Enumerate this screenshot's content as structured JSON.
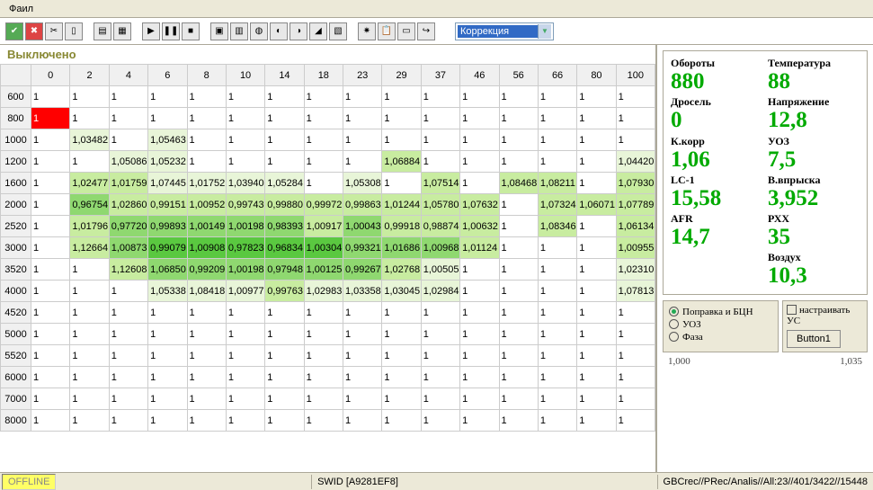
{
  "menu": {
    "file": "Фаил"
  },
  "toolbar": {
    "combo_label": "Коррекция"
  },
  "status_label": "Выключено",
  "columns": [
    "0",
    "2",
    "4",
    "6",
    "8",
    "10",
    "14",
    "18",
    "23",
    "29",
    "37",
    "46",
    "56",
    "66",
    "80",
    "100"
  ],
  "rows": [
    "600",
    "800",
    "1000",
    "1200",
    "1600",
    "2000",
    "2520",
    "3000",
    "3520",
    "4000",
    "4520",
    "5000",
    "5520",
    "6000",
    "7000",
    "8000"
  ],
  "cells": [
    [
      [
        "1",
        ""
      ],
      [
        "1",
        ""
      ],
      [
        "1",
        ""
      ],
      [
        "1",
        ""
      ],
      [
        "1",
        ""
      ],
      [
        "1",
        ""
      ],
      [
        "1",
        ""
      ],
      [
        "1",
        ""
      ],
      [
        "1",
        ""
      ],
      [
        "1",
        ""
      ],
      [
        "1",
        ""
      ],
      [
        "1",
        ""
      ],
      [
        "1",
        ""
      ],
      [
        "1",
        ""
      ],
      [
        "1",
        ""
      ],
      [
        "1",
        ""
      ]
    ],
    [
      [
        "1",
        "red"
      ],
      [
        "1",
        ""
      ],
      [
        "1",
        ""
      ],
      [
        "1",
        ""
      ],
      [
        "1",
        ""
      ],
      [
        "1",
        ""
      ],
      [
        "1",
        ""
      ],
      [
        "1",
        ""
      ],
      [
        "1",
        ""
      ],
      [
        "1",
        ""
      ],
      [
        "1",
        ""
      ],
      [
        "1",
        ""
      ],
      [
        "1",
        ""
      ],
      [
        "1",
        ""
      ],
      [
        "1",
        ""
      ],
      [
        "1",
        ""
      ]
    ],
    [
      [
        "1",
        ""
      ],
      [
        "1,03482",
        "g1"
      ],
      [
        "1",
        ""
      ],
      [
        "1,05463",
        "g1"
      ],
      [
        "1",
        ""
      ],
      [
        "1",
        ""
      ],
      [
        "1",
        ""
      ],
      [
        "1",
        ""
      ],
      [
        "1",
        ""
      ],
      [
        "1",
        ""
      ],
      [
        "1",
        ""
      ],
      [
        "1",
        ""
      ],
      [
        "1",
        ""
      ],
      [
        "1",
        ""
      ],
      [
        "1",
        ""
      ],
      [
        "1",
        ""
      ]
    ],
    [
      [
        "1",
        ""
      ],
      [
        "1",
        ""
      ],
      [
        "1,05086",
        "g1"
      ],
      [
        "1,05232",
        "g1"
      ],
      [
        "1",
        ""
      ],
      [
        "1",
        ""
      ],
      [
        "1",
        ""
      ],
      [
        "1",
        ""
      ],
      [
        "1",
        ""
      ],
      [
        "1,06884",
        "g2"
      ],
      [
        "1",
        ""
      ],
      [
        "1",
        ""
      ],
      [
        "1",
        ""
      ],
      [
        "1",
        ""
      ],
      [
        "1",
        ""
      ],
      [
        "1,04420",
        "g1"
      ]
    ],
    [
      [
        "1",
        ""
      ],
      [
        "1,02477",
        "g2"
      ],
      [
        "1,01759",
        "g2"
      ],
      [
        "1,07445",
        "g1"
      ],
      [
        "1,01752",
        "g1"
      ],
      [
        "1,03940",
        "g1"
      ],
      [
        "1,05284",
        "g1"
      ],
      [
        "1",
        ""
      ],
      [
        "1,05308",
        "g1"
      ],
      [
        "1",
        ""
      ],
      [
        "1,07514",
        "g2"
      ],
      [
        "1",
        ""
      ],
      [
        "1,08468",
        "g2"
      ],
      [
        "1,08211",
        "g2"
      ],
      [
        "1",
        ""
      ],
      [
        "1,07930",
        "g2"
      ]
    ],
    [
      [
        "1",
        ""
      ],
      [
        "0,96754",
        "g3"
      ],
      [
        "1,02860",
        "g2"
      ],
      [
        "0,99151",
        "g2"
      ],
      [
        "1,00952",
        "g2"
      ],
      [
        "0,99743",
        "g2"
      ],
      [
        "0,99880",
        "g2"
      ],
      [
        "0,99972",
        "g2"
      ],
      [
        "0,99863",
        "g2"
      ],
      [
        "1,01244",
        "g2"
      ],
      [
        "1,05780",
        "g2"
      ],
      [
        "1,07632",
        "g2"
      ],
      [
        "1",
        ""
      ],
      [
        "1,07324",
        "g2"
      ],
      [
        "1,06071",
        "g2"
      ],
      [
        "1,07789",
        "g2"
      ]
    ],
    [
      [
        "1",
        ""
      ],
      [
        "1,01796",
        "g2"
      ],
      [
        "0,97720",
        "g3"
      ],
      [
        "0,99893",
        "g3"
      ],
      [
        "1,00149",
        "g3"
      ],
      [
        "1,00198",
        "g3"
      ],
      [
        "0,98393",
        "g3"
      ],
      [
        "1,00917",
        "g2"
      ],
      [
        "1,00043",
        "g3"
      ],
      [
        "0,99918",
        "g2"
      ],
      [
        "0,98874",
        "g2"
      ],
      [
        "1,00632",
        "g2"
      ],
      [
        "1",
        ""
      ],
      [
        "1,08346",
        "g2"
      ],
      [
        "1",
        ""
      ],
      [
        "1,06134",
        "g2"
      ]
    ],
    [
      [
        "1",
        ""
      ],
      [
        "1,12664",
        "g2"
      ],
      [
        "1,00873",
        "g3"
      ],
      [
        "0,99079",
        "g4"
      ],
      [
        "1,00908",
        "g4"
      ],
      [
        "0,97823",
        "g4"
      ],
      [
        "0,96834",
        "g4"
      ],
      [
        "1,00304",
        "g4"
      ],
      [
        "0,99321",
        "g3"
      ],
      [
        "1,01686",
        "g3"
      ],
      [
        "1,00968",
        "g3"
      ],
      [
        "1,01124",
        "g2"
      ],
      [
        "1",
        ""
      ],
      [
        "1",
        ""
      ],
      [
        "1",
        ""
      ],
      [
        "1,00955",
        "g2"
      ]
    ],
    [
      [
        "1",
        ""
      ],
      [
        "1",
        ""
      ],
      [
        "1,12608",
        "g2"
      ],
      [
        "1,06850",
        "g3"
      ],
      [
        "0,99209",
        "g3"
      ],
      [
        "1,00198",
        "g3"
      ],
      [
        "0,97948",
        "g3"
      ],
      [
        "1,00125",
        "g3"
      ],
      [
        "0,99267",
        "g3"
      ],
      [
        "1,02768",
        "g2"
      ],
      [
        "1,00505",
        "g1"
      ],
      [
        "1",
        ""
      ],
      [
        "1",
        ""
      ],
      [
        "1",
        ""
      ],
      [
        "1",
        ""
      ],
      [
        "1,02310",
        "g1"
      ]
    ],
    [
      [
        "1",
        ""
      ],
      [
        "1",
        ""
      ],
      [
        "1",
        ""
      ],
      [
        "1,05338",
        "g1"
      ],
      [
        "1,08418",
        "g1"
      ],
      [
        "1,00977",
        "g1"
      ],
      [
        "0,99763",
        "g2"
      ],
      [
        "1,02983",
        "g1"
      ],
      [
        "1,03358",
        "g1"
      ],
      [
        "1,03045",
        "g1"
      ],
      [
        "1,02984",
        "g1"
      ],
      [
        "1",
        ""
      ],
      [
        "1",
        ""
      ],
      [
        "1",
        ""
      ],
      [
        "1",
        ""
      ],
      [
        "1,07813",
        "g1"
      ]
    ],
    [
      [
        "1",
        ""
      ],
      [
        "1",
        ""
      ],
      [
        "1",
        ""
      ],
      [
        "1",
        ""
      ],
      [
        "1",
        ""
      ],
      [
        "1",
        ""
      ],
      [
        "1",
        ""
      ],
      [
        "1",
        ""
      ],
      [
        "1",
        ""
      ],
      [
        "1",
        ""
      ],
      [
        "1",
        ""
      ],
      [
        "1",
        ""
      ],
      [
        "1",
        ""
      ],
      [
        "1",
        ""
      ],
      [
        "1",
        ""
      ],
      [
        "1",
        ""
      ]
    ],
    [
      [
        "1",
        ""
      ],
      [
        "1",
        ""
      ],
      [
        "1",
        ""
      ],
      [
        "1",
        ""
      ],
      [
        "1",
        ""
      ],
      [
        "1",
        ""
      ],
      [
        "1",
        ""
      ],
      [
        "1",
        ""
      ],
      [
        "1",
        ""
      ],
      [
        "1",
        ""
      ],
      [
        "1",
        ""
      ],
      [
        "1",
        ""
      ],
      [
        "1",
        ""
      ],
      [
        "1",
        ""
      ],
      [
        "1",
        ""
      ],
      [
        "1",
        ""
      ]
    ],
    [
      [
        "1",
        ""
      ],
      [
        "1",
        ""
      ],
      [
        "1",
        ""
      ],
      [
        "1",
        ""
      ],
      [
        "1",
        ""
      ],
      [
        "1",
        ""
      ],
      [
        "1",
        ""
      ],
      [
        "1",
        ""
      ],
      [
        "1",
        ""
      ],
      [
        "1",
        ""
      ],
      [
        "1",
        ""
      ],
      [
        "1",
        ""
      ],
      [
        "1",
        ""
      ],
      [
        "1",
        ""
      ],
      [
        "1",
        ""
      ],
      [
        "1",
        ""
      ]
    ],
    [
      [
        "1",
        ""
      ],
      [
        "1",
        ""
      ],
      [
        "1",
        ""
      ],
      [
        "1",
        ""
      ],
      [
        "1",
        ""
      ],
      [
        "1",
        ""
      ],
      [
        "1",
        ""
      ],
      [
        "1",
        ""
      ],
      [
        "1",
        ""
      ],
      [
        "1",
        ""
      ],
      [
        "1",
        ""
      ],
      [
        "1",
        ""
      ],
      [
        "1",
        ""
      ],
      [
        "1",
        ""
      ],
      [
        "1",
        ""
      ],
      [
        "1",
        ""
      ]
    ],
    [
      [
        "1",
        ""
      ],
      [
        "1",
        ""
      ],
      [
        "1",
        ""
      ],
      [
        "1",
        ""
      ],
      [
        "1",
        ""
      ],
      [
        "1",
        ""
      ],
      [
        "1",
        ""
      ],
      [
        "1",
        ""
      ],
      [
        "1",
        ""
      ],
      [
        "1",
        ""
      ],
      [
        "1",
        ""
      ],
      [
        "1",
        ""
      ],
      [
        "1",
        ""
      ],
      [
        "1",
        ""
      ],
      [
        "1",
        ""
      ],
      [
        "1",
        ""
      ]
    ],
    [
      [
        "1",
        ""
      ],
      [
        "1",
        ""
      ],
      [
        "1",
        ""
      ],
      [
        "1",
        ""
      ],
      [
        "1",
        ""
      ],
      [
        "1",
        ""
      ],
      [
        "1",
        ""
      ],
      [
        "1",
        ""
      ],
      [
        "1",
        ""
      ],
      [
        "1",
        ""
      ],
      [
        "1",
        ""
      ],
      [
        "1",
        ""
      ],
      [
        "1",
        ""
      ],
      [
        "1",
        ""
      ],
      [
        "1",
        ""
      ],
      [
        "1",
        ""
      ]
    ]
  ],
  "gauges": [
    {
      "label": "Обороты",
      "value": "880"
    },
    {
      "label": "Температура",
      "value": "88"
    },
    {
      "label": "Дросель",
      "value": "0"
    },
    {
      "label": "Напряжение",
      "value": "12,8"
    },
    {
      "label": "К.корр",
      "value": "1,06"
    },
    {
      "label": "УОЗ",
      "value": "7,5"
    },
    {
      "label": "LC-1",
      "value": "15,58"
    },
    {
      "label": "В.впрыска",
      "value": "3,952"
    },
    {
      "label": "AFR",
      "value": "14,7"
    },
    {
      "label": "РХХ",
      "value": "35"
    },
    {
      "label": "",
      "value": ""
    },
    {
      "label": "Воздух",
      "value": "10,3"
    }
  ],
  "radios": {
    "opt1": "Поправка и БЦН",
    "opt2": "УОЗ",
    "opt3": "Фаза"
  },
  "checkbox": "настраивать УС",
  "button1": "Button1",
  "range": {
    "min": "1,000",
    "max": "1,035"
  },
  "statusbar": {
    "offline": "OFFLINE",
    "swid": "SWID [A9281EF8]",
    "path": "GBCrec//PRec/Analis//All:23//401/3422//15448"
  }
}
